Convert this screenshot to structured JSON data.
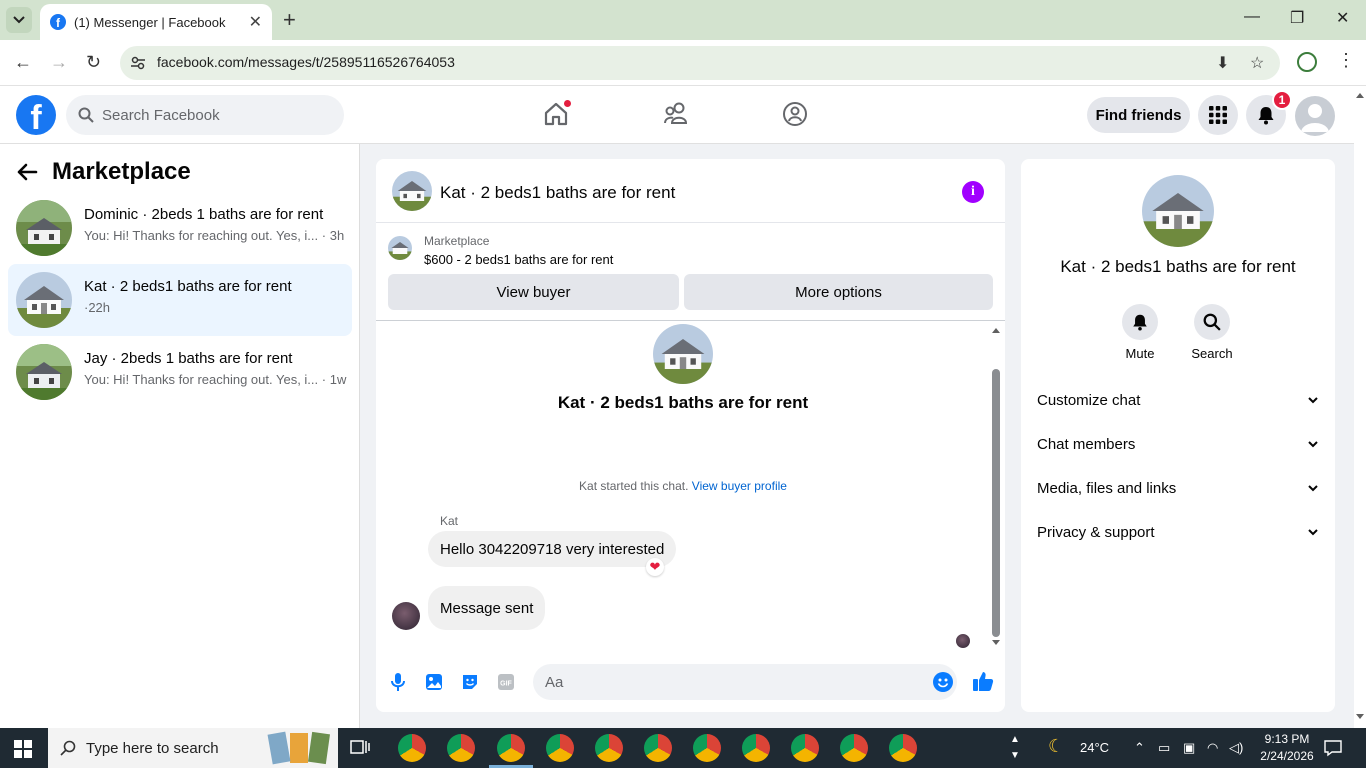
{
  "browser": {
    "tab_title": "(1) Messenger | Facebook",
    "url": "facebook.com/messages/t/25895116526764053"
  },
  "fb": {
    "search_placeholder": "Search Facebook",
    "find_friends_label": "Find friends",
    "notification_count": "1"
  },
  "left": {
    "title": "Marketplace",
    "conversations": [
      {
        "name": "Dominic · 2beds 1 baths are for rent",
        "snippet": "You: Hi! Thanks for reaching out. Yes, i...",
        "time": "3h"
      },
      {
        "name": "Kat · 2 beds1 baths are for rent",
        "snippet": "",
        "time": "·22h"
      },
      {
        "name": "Jay · 2beds 1 baths are for rent",
        "snippet": "You: Hi! Thanks for reaching out. Yes, i...",
        "time": "1w"
      }
    ]
  },
  "chat": {
    "header_name": "Kat · 2 beds1 baths are for rent",
    "listing_label": "Marketplace",
    "listing_price": "$600 - 2 beds1 baths are for rent",
    "view_buyer_label": "View buyer",
    "more_options_label": "More options",
    "intro_name": "Kat · 2 beds1 baths are for rent",
    "started_text": "Kat started this chat.",
    "view_profile_link": "View buyer profile",
    "sender_name": "Kat",
    "message_1": "Hello 3042209718 very interested",
    "message_2": "Message sent",
    "composer_placeholder": "Aa"
  },
  "right": {
    "name": "Kat · 2 beds1 baths are for rent",
    "mute_label": "Mute",
    "search_label": "Search",
    "sections": [
      "Customize chat",
      "Chat members",
      "Media, files and links",
      "Privacy & support"
    ]
  },
  "taskbar": {
    "search_placeholder": "Type here to search",
    "weather": "24°C",
    "time": "9:13 PM",
    "date": "2/24/2026"
  },
  "colors": {
    "fb_blue": "#1877f2",
    "messenger_purple": "#a100ff",
    "link_blue": "#0064d1",
    "badge_red": "#e41e3f"
  }
}
